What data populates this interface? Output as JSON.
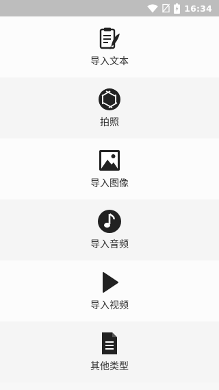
{
  "status_bar": {
    "time": "16:34",
    "icons": [
      "wifi-icon",
      "no-sim-icon",
      "battery-charging-icon"
    ]
  },
  "menu": {
    "items": [
      {
        "label": "导入文本",
        "icon": "document-edit-icon"
      },
      {
        "label": "拍照",
        "icon": "camera-shutter-icon"
      },
      {
        "label": "导入图像",
        "icon": "image-icon"
      },
      {
        "label": "导入音频",
        "icon": "music-note-icon"
      },
      {
        "label": "导入视频",
        "icon": "play-icon"
      },
      {
        "label": "其他类型",
        "icon": "file-icon"
      }
    ]
  },
  "colors": {
    "status_bar_bg": "#bdbdbd",
    "icon": "#222222",
    "label": "#333333",
    "row_light": "#fcfcfc",
    "row_dark": "#f5f5f5"
  }
}
